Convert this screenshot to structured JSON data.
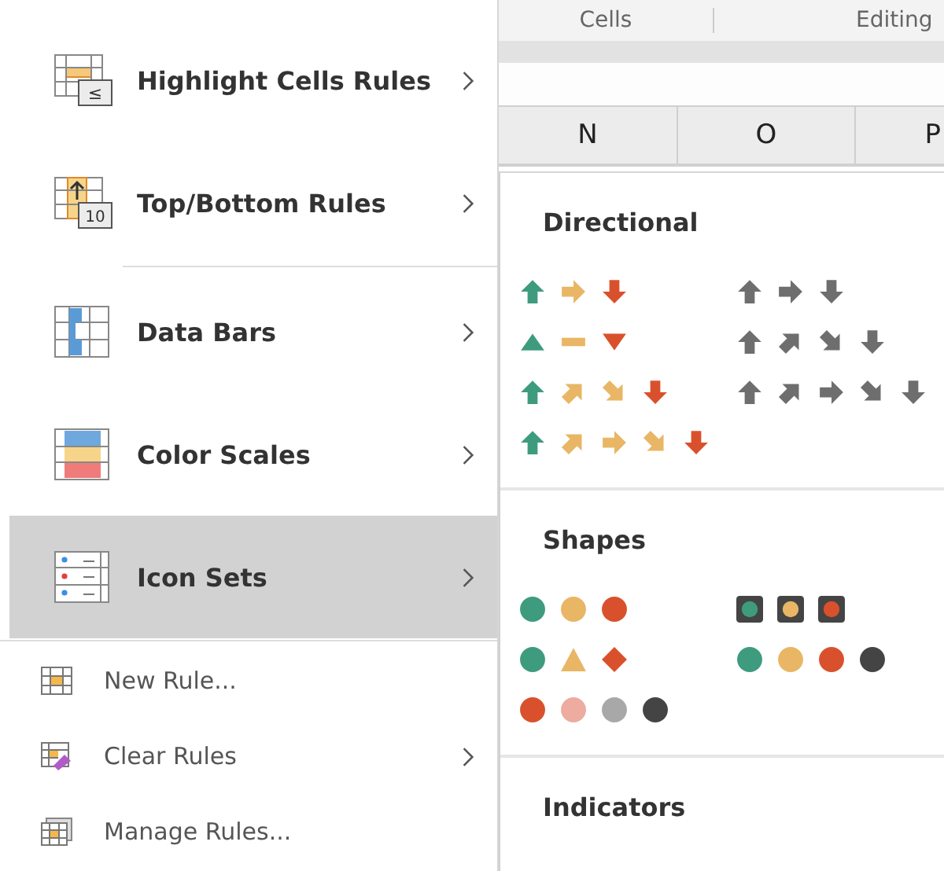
{
  "menu": {
    "main_items": [
      {
        "label": "Highlight Cells Rules",
        "icon_text": "≤",
        "has_submenu": true,
        "selected": false
      },
      {
        "label": "Top/Bottom Rules",
        "icon_text": "10",
        "has_submenu": true,
        "selected": false
      },
      {
        "label": "Data Bars",
        "has_submenu": true,
        "selected": false
      },
      {
        "label": "Color Scales",
        "has_submenu": true,
        "selected": false
      },
      {
        "label": "Icon Sets",
        "has_submenu": true,
        "selected": true
      }
    ],
    "rule_items": [
      {
        "label": "New Rule...",
        "has_submenu": false
      },
      {
        "label": "Clear Rules",
        "has_submenu": true
      },
      {
        "label": "Manage Rules...",
        "has_submenu": false
      }
    ]
  },
  "ribbon": {
    "groups": [
      "Cells",
      "Editing"
    ]
  },
  "sheet": {
    "columns": [
      "N",
      "O",
      "P"
    ]
  },
  "submenu": {
    "sections": [
      {
        "title": "Directional",
        "icon_sets": [
          {
            "icons": [
              {
                "kind": "up",
                "color": "#3f9b7e"
              },
              {
                "kind": "right",
                "color": "#e8b665"
              },
              {
                "kind": "down",
                "color": "#d9512c"
              }
            ]
          },
          {
            "icons": [
              {
                "kind": "up",
                "color": "#6e6e6e"
              },
              {
                "kind": "right",
                "color": "#6e6e6e"
              },
              {
                "kind": "down",
                "color": "#6e6e6e"
              }
            ]
          },
          {
            "icons": [
              {
                "kind": "triangle-up",
                "color": "#3f9b7e"
              },
              {
                "kind": "dash",
                "color": "#e8b665"
              },
              {
                "kind": "triangle-down",
                "color": "#d9512c"
              }
            ]
          },
          {
            "icons": [
              {
                "kind": "up",
                "color": "#6e6e6e"
              },
              {
                "kind": "up-right",
                "color": "#6e6e6e"
              },
              {
                "kind": "down-right",
                "color": "#6e6e6e"
              },
              {
                "kind": "down",
                "color": "#6e6e6e"
              }
            ]
          },
          {
            "icons": [
              {
                "kind": "up",
                "color": "#3f9b7e"
              },
              {
                "kind": "up-right",
                "color": "#e8b665"
              },
              {
                "kind": "down-right",
                "color": "#e8b665"
              },
              {
                "kind": "down",
                "color": "#d9512c"
              }
            ]
          },
          {
            "icons": [
              {
                "kind": "up",
                "color": "#6e6e6e"
              },
              {
                "kind": "up-right",
                "color": "#6e6e6e"
              },
              {
                "kind": "right",
                "color": "#6e6e6e"
              },
              {
                "kind": "down-right",
                "color": "#6e6e6e"
              },
              {
                "kind": "down",
                "color": "#6e6e6e"
              }
            ]
          },
          {
            "icons": [
              {
                "kind": "up",
                "color": "#3f9b7e"
              },
              {
                "kind": "up-right",
                "color": "#e8b665"
              },
              {
                "kind": "right",
                "color": "#e8b665"
              },
              {
                "kind": "down-right",
                "color": "#e8b665"
              },
              {
                "kind": "down",
                "color": "#d9512c"
              }
            ]
          }
        ]
      },
      {
        "title": "Shapes",
        "icon_sets": [
          {
            "icons": [
              {
                "kind": "circle",
                "color": "#3f9b7e"
              },
              {
                "kind": "circle",
                "color": "#e8b665"
              },
              {
                "kind": "circle",
                "color": "#d9512c"
              }
            ]
          },
          {
            "icons": [
              {
                "kind": "framed-circle",
                "color": "#3f9b7e"
              },
              {
                "kind": "framed-circle",
                "color": "#e8b665"
              },
              {
                "kind": "framed-circle",
                "color": "#d9512c"
              }
            ]
          },
          {
            "icons": [
              {
                "kind": "circle",
                "color": "#3f9b7e"
              },
              {
                "kind": "triangle",
                "color": "#e8b665"
              },
              {
                "kind": "diamond",
                "color": "#d9512c"
              }
            ]
          },
          {
            "icons": [
              {
                "kind": "circle",
                "color": "#3f9b7e"
              },
              {
                "kind": "circle",
                "color": "#e8b665"
              },
              {
                "kind": "circle",
                "color": "#d9512c"
              },
              {
                "kind": "circle",
                "color": "#444444"
              }
            ]
          },
          {
            "icons": [
              {
                "kind": "circle",
                "color": "#d9512c"
              },
              {
                "kind": "circle",
                "color": "#eeaba0"
              },
              {
                "kind": "circle",
                "color": "#a8a8a8"
              },
              {
                "kind": "circle",
                "color": "#444444"
              }
            ]
          }
        ]
      },
      {
        "title": "Indicators"
      }
    ]
  }
}
